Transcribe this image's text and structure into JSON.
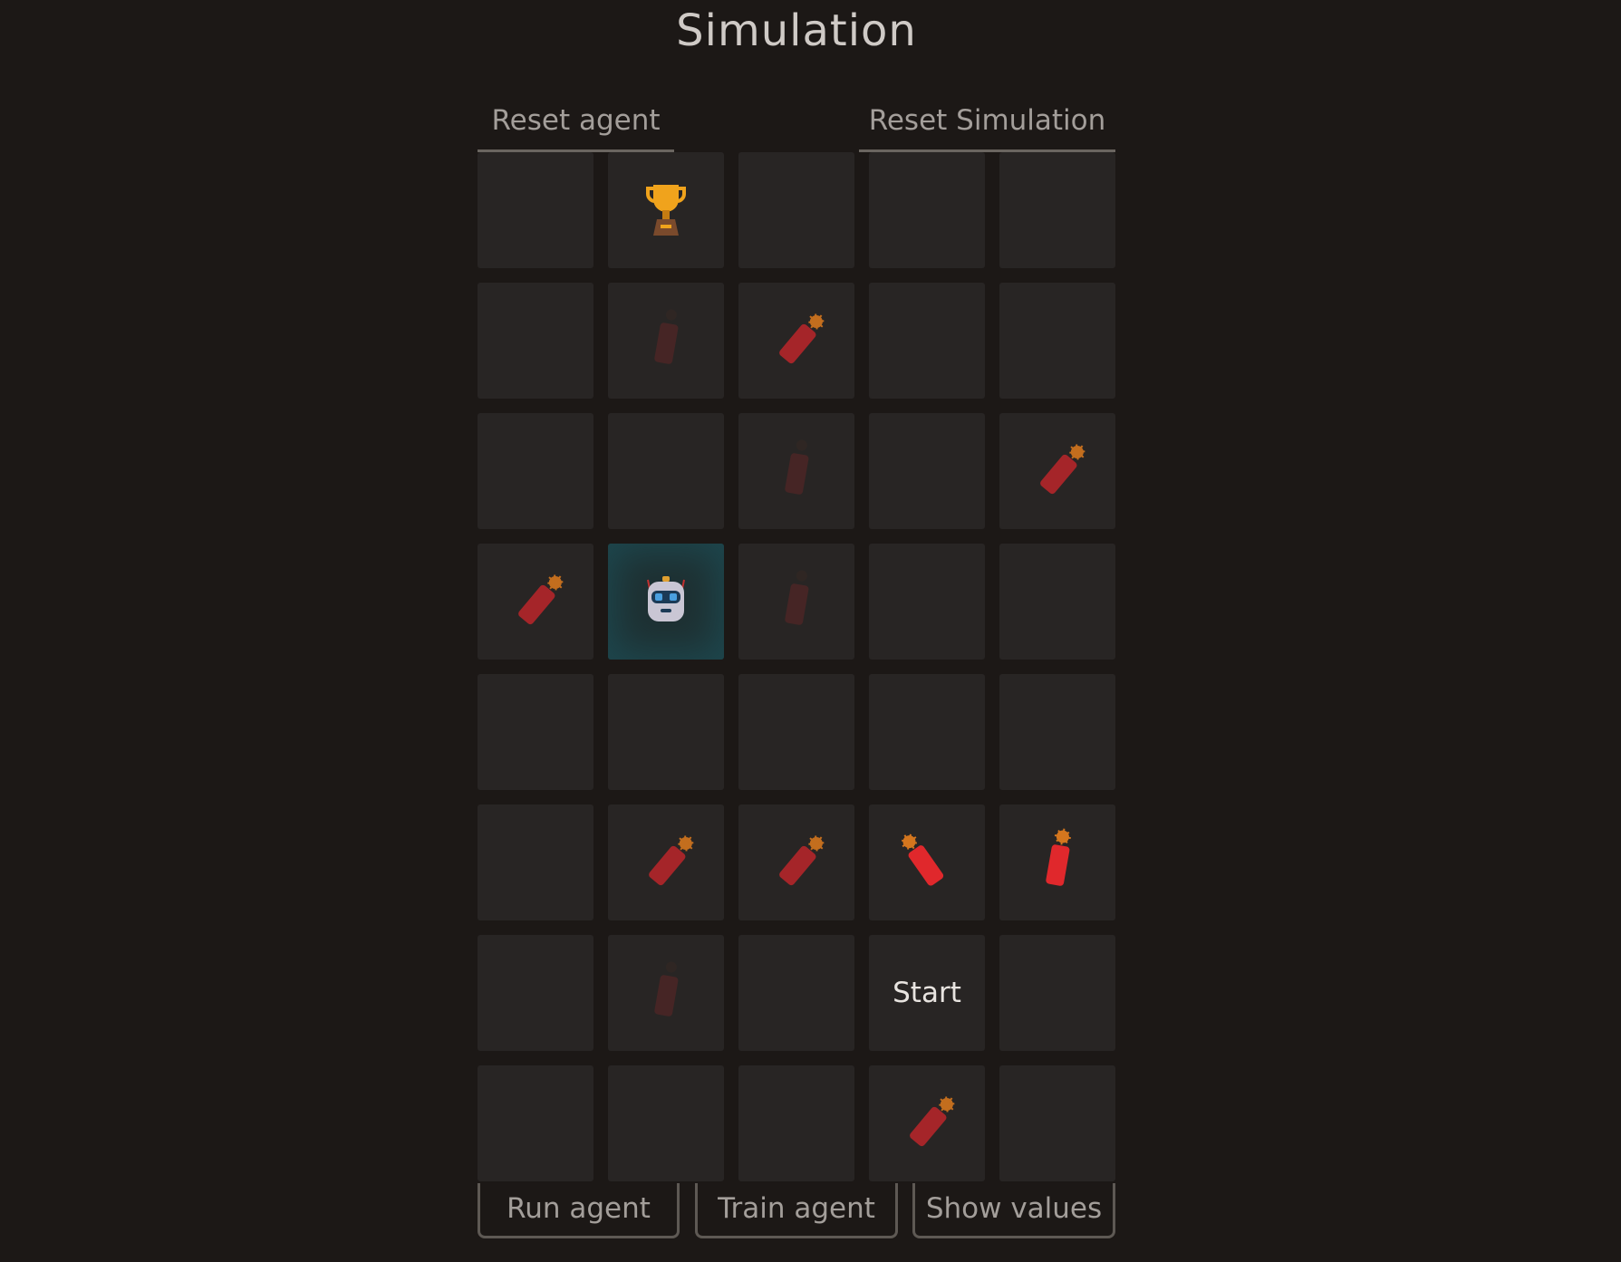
{
  "title": "Simulation",
  "controls": {
    "reset_agent": "Reset agent",
    "reset_simulation": "Reset Simulation",
    "run_agent": "Run agent",
    "train_agent": "Train agent",
    "show_values": "Show values"
  },
  "grid": {
    "rows": 8,
    "cols": 5,
    "cells": [
      [
        "empty",
        "trophy",
        "empty",
        "empty",
        "empty"
      ],
      [
        "empty",
        "faded-dynamite",
        "dynamite",
        "empty",
        "empty"
      ],
      [
        "empty",
        "empty",
        "faded-dynamite",
        "empty",
        "dynamite"
      ],
      [
        "dynamite",
        "agent",
        "faded-dynamite",
        "empty",
        "empty"
      ],
      [
        "empty",
        "empty",
        "empty",
        "empty",
        "empty"
      ],
      [
        "empty",
        "dynamite",
        "dynamite",
        "dynamite-bright-right",
        "dynamite-bright-up"
      ],
      [
        "empty",
        "faded-dynamite",
        "empty",
        "start",
        "empty"
      ],
      [
        "empty",
        "empty",
        "empty",
        "dynamite",
        "empty"
      ]
    ],
    "start_label": "Start"
  },
  "icons": {
    "trophy": "trophy-icon",
    "dynamite": "dynamite-icon",
    "agent": "robot-icon"
  },
  "colors": {
    "background": "#1c1816",
    "cell": "#282524",
    "dynamite": "#b3262a",
    "dynamite_bright": "#e0282c",
    "fuse": "#d4761e",
    "trophy": "#f0a31c",
    "agent_glow": "#1e5a64"
  }
}
